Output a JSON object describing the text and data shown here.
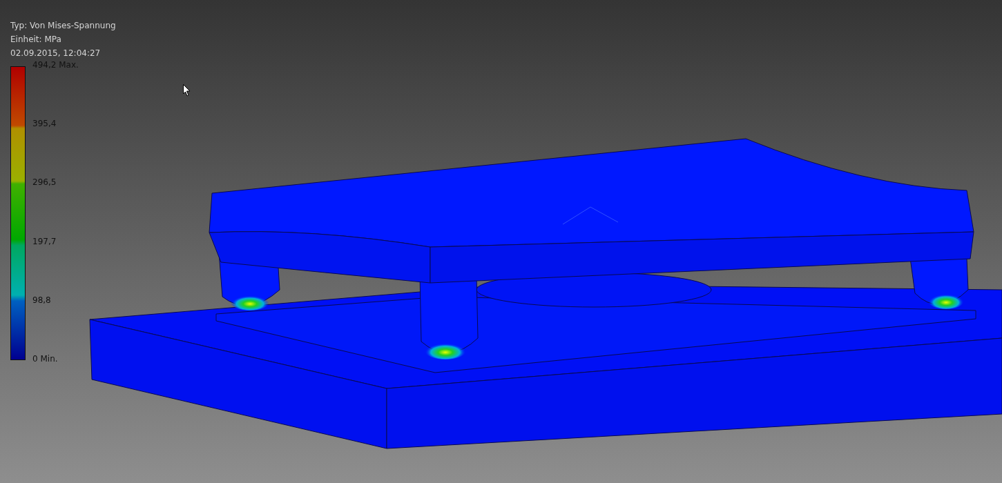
{
  "legend": {
    "type_line": "Typ: Von Mises-Spannung",
    "unit_line": "Einheit: MPa",
    "timestamp": "02.09.2015, 12:04:27",
    "scale_labels": [
      "494,2 Max.",
      "395,4",
      "296,5",
      "197,7",
      "98,8",
      "0 Min."
    ]
  }
}
